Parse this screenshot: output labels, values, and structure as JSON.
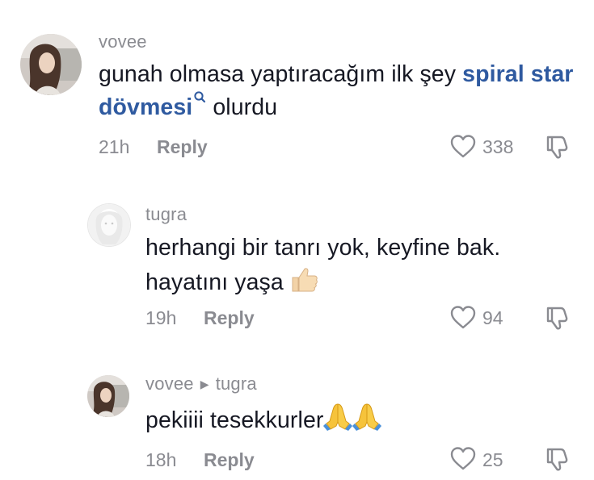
{
  "comments": [
    {
      "username": "vovee",
      "text_before": "gunah olmasa yaptıracağım ilk şey ",
      "link_text": "spiral star dövmesi",
      "text_after": " olurdu",
      "time": "21h",
      "reply_label": "Reply",
      "likes": "338"
    },
    {
      "username": "tugra",
      "text_line1": "herhangi bir tanrı yok, keyfine bak.",
      "text_line2": "hayatını yaşa",
      "time": "19h",
      "reply_label": "Reply",
      "likes": "94",
      "emoji": "thumbs-up"
    },
    {
      "username": "vovee",
      "reply_to": "tugra",
      "text": "pekiiii tesekkurler",
      "time": "18h",
      "reply_label": "Reply",
      "likes": "25",
      "emoji": "folded-hands"
    }
  ],
  "colors": {
    "link": "#2f5aa0",
    "muted": "#8a8b91",
    "text": "#161823"
  }
}
